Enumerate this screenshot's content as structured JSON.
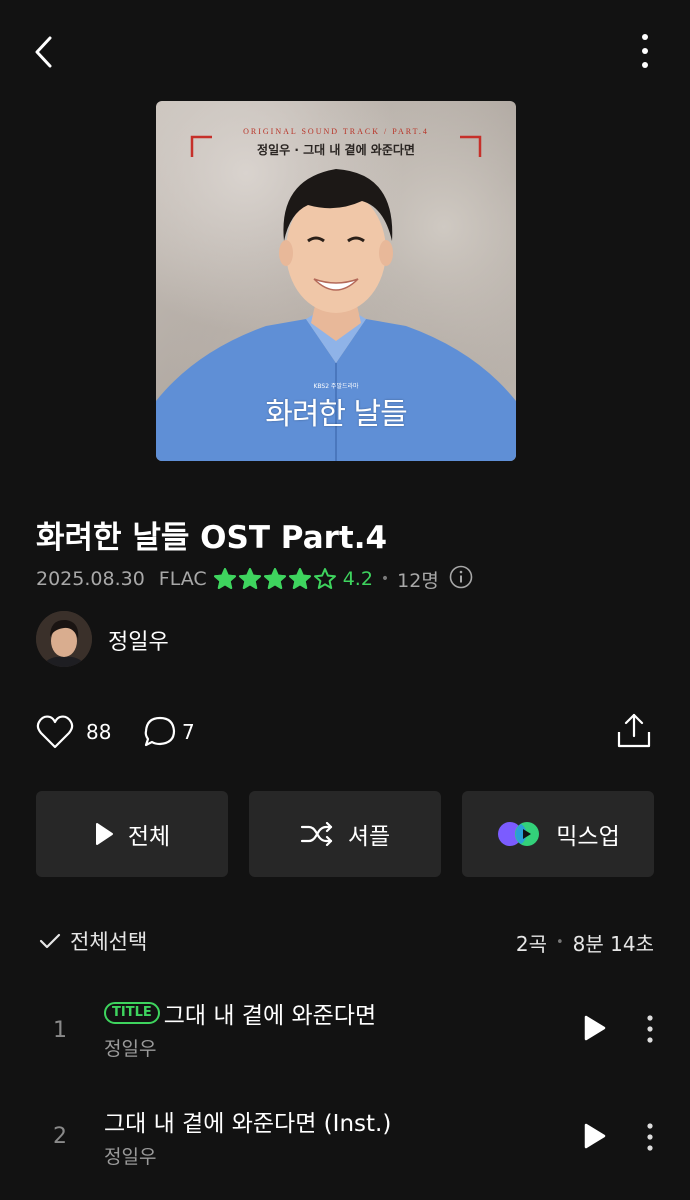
{
  "album": {
    "title": "화려한 날들 OST Part.4",
    "date": "2025.08.30",
    "format": "FLAC",
    "rating": "4.2",
    "rating_value": 4.2,
    "rating_max": 5,
    "rater_count": "12명",
    "accent_color": "#3ed45e"
  },
  "cover": {
    "ost_line": "ORIGINAL SOUND TRACK / PART.4",
    "subtitle": "정일우 · 그대 내 곁에 와준다면",
    "logo_small": "KBS2 주말드라마",
    "logo": "화려한 날들"
  },
  "artist": {
    "name": "정일우"
  },
  "social": {
    "likes": "88",
    "comments": "7"
  },
  "actions": {
    "play_all": "전체",
    "shuffle": "셔플",
    "mixup": "믹스업"
  },
  "list_header": {
    "select_all": "전체선택",
    "track_count": "2곡",
    "duration": "8분 14초"
  },
  "tracks": [
    {
      "num": "1",
      "badge": "TITLE",
      "title": "그대 내 곁에 와준다면",
      "artist": "정일우"
    },
    {
      "num": "2",
      "badge": "",
      "title": "그대 내 곁에 와준다면 (Inst.)",
      "artist": "정일우"
    }
  ],
  "icons": {
    "back": "chevron-left-icon",
    "more": "more-vertical-icon",
    "star": "star-icon",
    "info": "info-icon",
    "like": "heart-icon",
    "comment": "comment-icon",
    "share": "share-icon",
    "play": "play-icon",
    "shuffle": "shuffle-icon",
    "mixup": "mixup-icon",
    "check": "check-icon"
  }
}
